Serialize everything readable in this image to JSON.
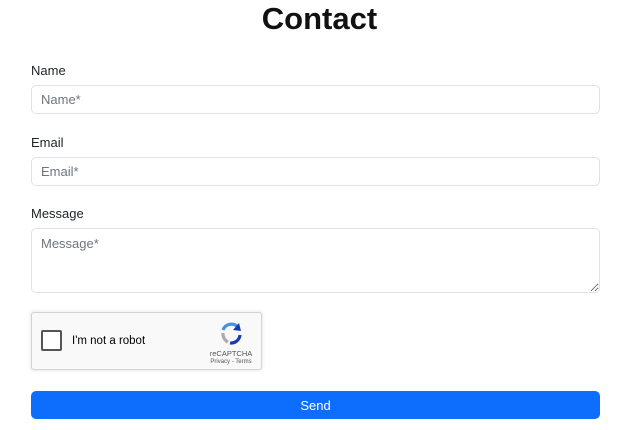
{
  "page": {
    "title": "Contact"
  },
  "form": {
    "name": {
      "label": "Name",
      "value": "",
      "placeholder": "Name*"
    },
    "email": {
      "label": "Email",
      "value": "",
      "placeholder": "Email*"
    },
    "message": {
      "label": "Message",
      "value": "",
      "placeholder": "Message*"
    },
    "recaptcha": {
      "checkbox_label": "I'm not a robot",
      "brand": "reCAPTCHA",
      "privacy_link": "Privacy",
      "separator": "-",
      "terms_link": "Terms",
      "checked": false,
      "icon": "recaptcha-logo-icon"
    },
    "submit_label": "Send"
  },
  "colors": {
    "primary": "#0d6efd",
    "input_border": "#dee2e6",
    "placeholder": "#6c757d",
    "recaptcha_bg": "#f9f9f9",
    "recaptcha_blue": "#1c3aa9",
    "recaptcha_lightblue": "#4a90e2",
    "recaptcha_gray": "#ababab"
  }
}
